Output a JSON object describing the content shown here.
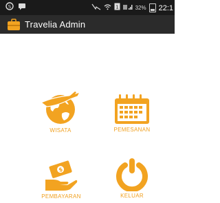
{
  "status_bar": {
    "battery_percent": "32%",
    "time": "22:1",
    "icons": [
      "skype-icon",
      "message-icon",
      "notification-icon",
      "wifi-icon",
      "sim-icon",
      "signal-icon",
      "battery-icon"
    ]
  },
  "app_bar": {
    "title": "Travelia Admin",
    "icon": "suitcase-icon"
  },
  "menu": {
    "items": [
      {
        "label": "WISATA",
        "icon": "globe-airplane-icon"
      },
      {
        "label": "PEMESANAN",
        "icon": "calendar-icon"
      },
      {
        "label": "PEMBAYARAN",
        "icon": "hand-money-icon"
      },
      {
        "label": "KELUAR",
        "icon": "power-icon"
      }
    ]
  },
  "colors": {
    "accent": "#f2a321",
    "status_bar_bg": "#1a1a1a",
    "app_bar_bg": "#2b2b2b",
    "background": "#ffffff"
  }
}
